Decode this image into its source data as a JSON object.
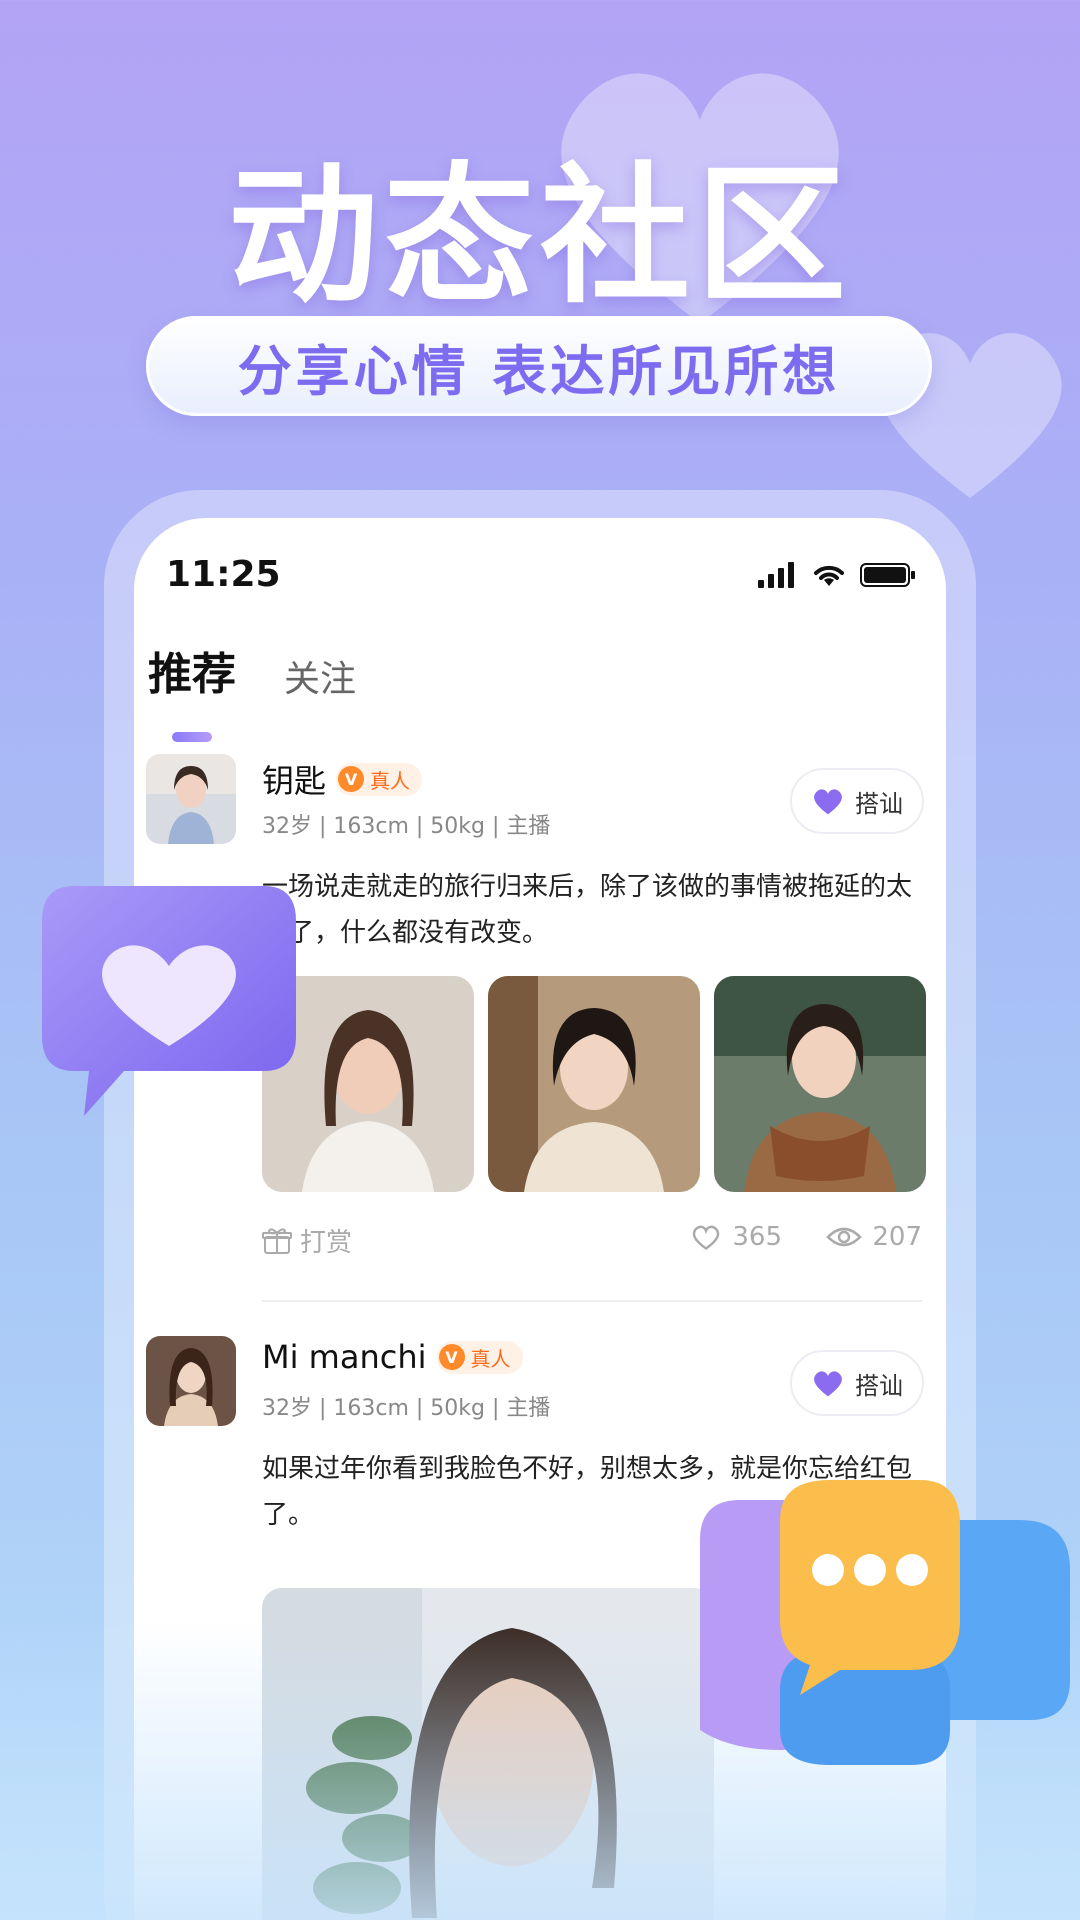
{
  "hero": {
    "title": "动态社区",
    "subtitle": "分享心情  表达所见所想"
  },
  "status_bar": {
    "time": "11:25",
    "icons": [
      "signal-icon",
      "wifi-icon",
      "battery-icon"
    ]
  },
  "tabs": [
    {
      "label": "推荐",
      "active": true
    },
    {
      "label": "关注",
      "active": false
    }
  ],
  "posts": [
    {
      "name": "钥匙",
      "badge": "真人",
      "badge_icon": "V",
      "meta": "32岁 | 163cm | 50kg | 主播",
      "greet_label": "搭讪",
      "text": "一场说走就走的旅行归来后，除了该做的事情被拖延的太久了，什么都没有改变。",
      "photos": [
        "woman-white-top-photo",
        "woman-short-hair-photo",
        "woman-scarf-photo"
      ],
      "tip_label": "打赏",
      "likes": "365",
      "views": "207"
    },
    {
      "name": "Mi manchi",
      "badge": "真人",
      "badge_icon": "V",
      "meta": "32岁 | 163cm | 50kg | 主播",
      "greet_label": "搭讪",
      "text": "如果过年你看到我脸色不好，别想太多，就是你忘给红包了。",
      "photos": [
        "woman-selfie-photo"
      ]
    }
  ],
  "colors": {
    "accent": "#8a7bf5",
    "badge_orange": "#ff8a2a",
    "heart_purple": "#8b6cf0"
  }
}
